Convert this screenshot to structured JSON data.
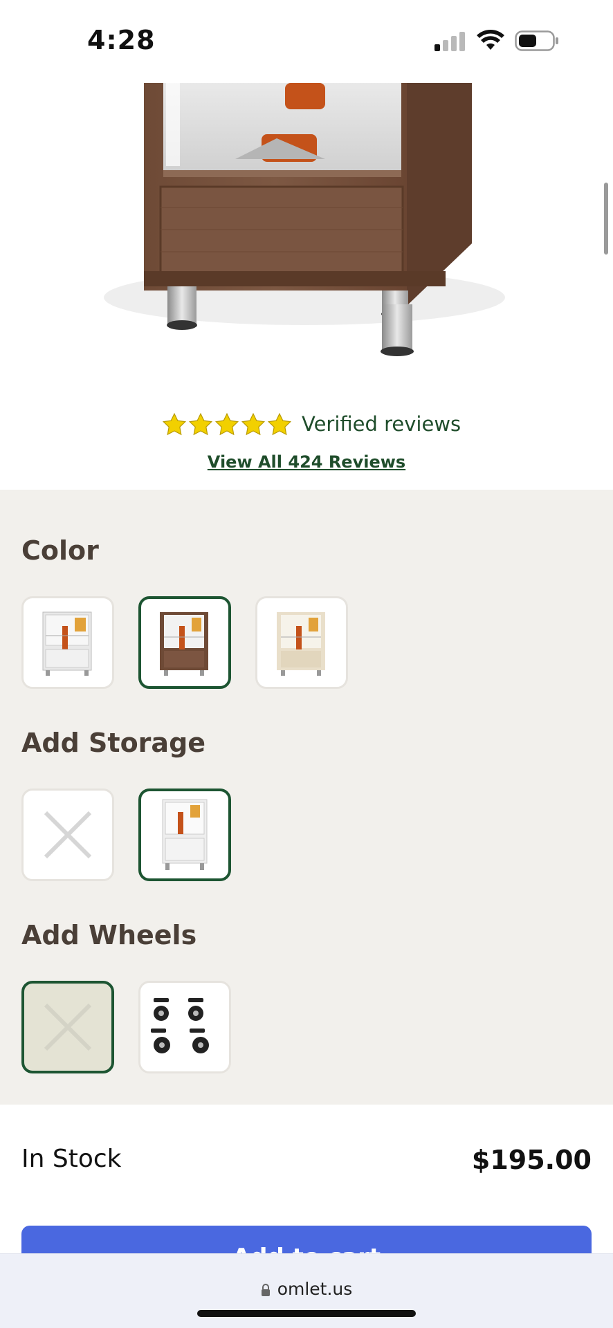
{
  "status_bar": {
    "time": "4:28"
  },
  "product": {
    "rating_stars": 5,
    "verified_label": "Verified reviews",
    "view_all_label": "View All 424 Reviews"
  },
  "options": {
    "color": {
      "title": "Color",
      "swatches": [
        {
          "name": "white",
          "selected": false
        },
        {
          "name": "walnut",
          "selected": true
        },
        {
          "name": "oak",
          "selected": false
        }
      ]
    },
    "storage": {
      "title": "Add Storage",
      "choices": [
        {
          "name": "none",
          "selected": false
        },
        {
          "name": "storage-cabinet",
          "selected": true
        }
      ]
    },
    "wheels": {
      "title": "Add Wheels",
      "choices": [
        {
          "name": "none",
          "selected": true
        },
        {
          "name": "caster-wheels",
          "selected": false
        }
      ]
    }
  },
  "purchase": {
    "stock_label": "In Stock",
    "price": "$195.00",
    "add_button_label": "Add to cart"
  },
  "browser": {
    "url": "omlet.us"
  },
  "colors": {
    "accent_green": "#1d5532",
    "button_blue": "#4a68e0",
    "panel_bg": "#f2f0ec",
    "star_yellow": "#f2d000"
  }
}
